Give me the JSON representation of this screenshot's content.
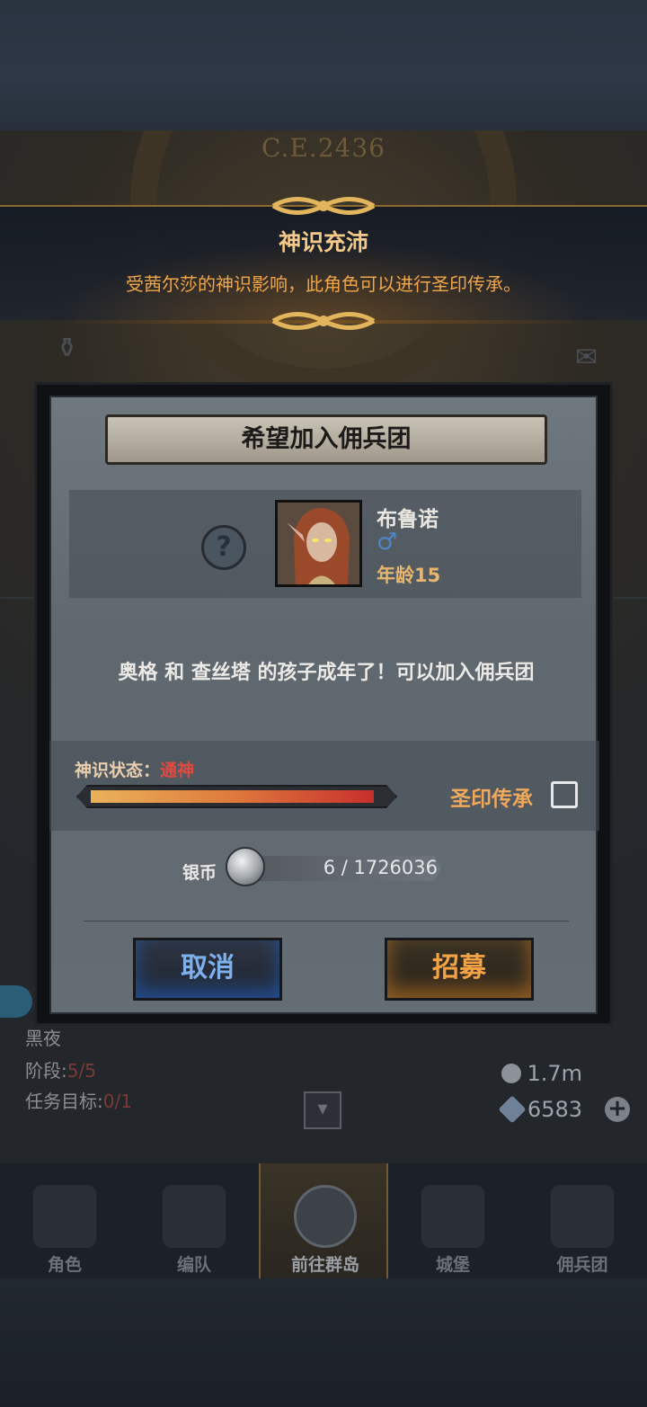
{
  "scene": {
    "year": "C.E.2436"
  },
  "banner": {
    "title": "神识充沛",
    "subtitle": "受茜尔莎的神识影响，此角色可以进行圣印传承。"
  },
  "hud": {
    "mission_name": "黑夜",
    "stage_label": "阶段:",
    "stage_value": "5/5",
    "goal_label": "任务目标:",
    "goal_value": "0/1",
    "silver_amount": "1.7m",
    "crystal_amount": "6583",
    "plus_symbol": "+"
  },
  "nav": {
    "items": [
      {
        "label": "角色",
        "icon": "knight-icon"
      },
      {
        "label": "编队",
        "icon": "helmet-icon"
      },
      {
        "label": "前往群岛",
        "icon": "globe-icon",
        "active": true
      },
      {
        "label": "城堡",
        "icon": "castle-icon"
      },
      {
        "label": "佣兵团",
        "icon": "mercenary-icon"
      }
    ]
  },
  "dialog": {
    "title": "希望加入佣兵团",
    "unknown_symbol": "?",
    "character": {
      "name": "布鲁诺",
      "gender_symbol": "♂",
      "age_label": "年龄",
      "age_value": "15"
    },
    "message": "奥格 和 查丝塔 的孩子成年了！可以加入佣兵团",
    "divine_state": {
      "label": "神识状态：",
      "value": "通神",
      "fill_fraction": 0.97
    },
    "seal_inherit_label": "圣印传承",
    "seal_inherit_checked": false,
    "coin": {
      "label": "银币",
      "cost_text": "6 / 1726036"
    },
    "buttons": {
      "cancel": "取消",
      "recruit": "招募"
    }
  },
  "colors": {
    "accent_gold": "#f4c98a",
    "subtitle_orange": "#f0a64a",
    "state_red": "#e04a40",
    "cancel_blue": "#7fb0ee",
    "recruit_orange": "#f3a246"
  }
}
